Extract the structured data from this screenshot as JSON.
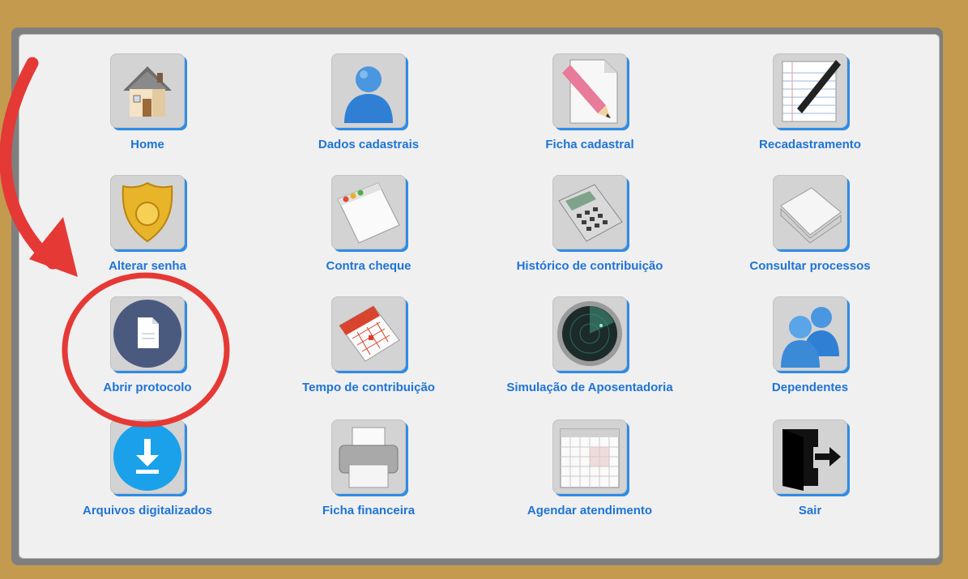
{
  "menu": {
    "items": [
      {
        "key": "home",
        "label": "Home",
        "icon": "house-icon"
      },
      {
        "key": "dados",
        "label": "Dados cadastrais",
        "icon": "user-icon"
      },
      {
        "key": "ficha",
        "label": "Ficha cadastral",
        "icon": "document-pencil-icon"
      },
      {
        "key": "recad",
        "label": "Recadastramento",
        "icon": "notepad-pen-icon"
      },
      {
        "key": "senha",
        "label": "Alterar senha",
        "icon": "badge-icon"
      },
      {
        "key": "cheque",
        "label": "Contra cheque",
        "icon": "window-icon"
      },
      {
        "key": "historico",
        "label": "Histórico de contribuição",
        "icon": "calculator-icon"
      },
      {
        "key": "processos",
        "label": "Consultar processos",
        "icon": "folder-icon"
      },
      {
        "key": "protocolo",
        "label": "Abrir protocolo",
        "icon": "file-circle-icon"
      },
      {
        "key": "tempo",
        "label": "Tempo de contribuição",
        "icon": "calendar-icon"
      },
      {
        "key": "simulacao",
        "label": "Simulação de Aposentadoria",
        "icon": "radar-icon"
      },
      {
        "key": "dependentes",
        "label": "Dependentes",
        "icon": "users-icon"
      },
      {
        "key": "arquivos",
        "label": "Arquivos digitalizados",
        "icon": "download-icon"
      },
      {
        "key": "financeira",
        "label": "Ficha financeira",
        "icon": "printer-icon"
      },
      {
        "key": "agendar",
        "label": "Agendar atendimento",
        "icon": "calendar-grid-icon"
      },
      {
        "key": "sair",
        "label": "Sair",
        "icon": "exit-door-icon"
      }
    ]
  },
  "colors": {
    "frame": "#c49a4e",
    "label": "#1e74d6",
    "accent": "#2f8ce6",
    "highlight": "#e53935"
  }
}
